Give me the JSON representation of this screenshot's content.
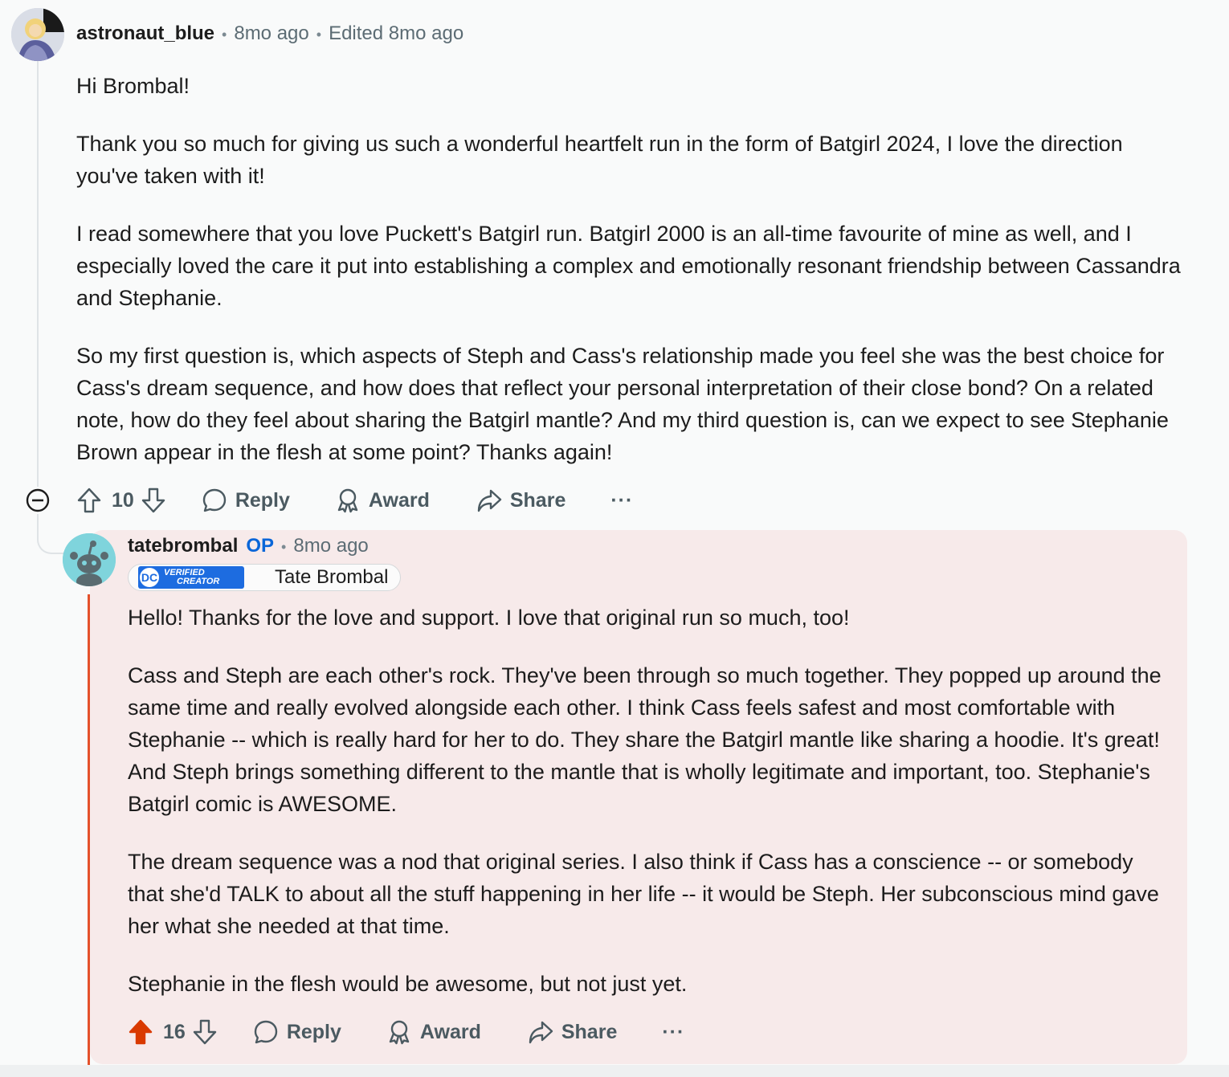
{
  "comment": {
    "username": "astronaut_blue",
    "time": "8mo ago",
    "edited": "Edited 8mo ago",
    "paragraphs": [
      "Hi Brombal!",
      "Thank you so much for giving us such a wonderful heartfelt run in the form of Batgirl 2024, I love the direction you've taken with it!",
      "I read somewhere that you love Puckett's Batgirl run. Batgirl 2000 is an all-time favourite of mine as well, and I especially loved the care it put into establishing a complex and emotionally resonant friendship between Cassandra and Stephanie.",
      "So my first question is, which aspects of Steph and Cass's relationship made you feel she was the best choice for Cass's dream sequence, and how does that reflect your personal interpretation of their close bond? On a related note, how do they feel about sharing the Batgirl mantle? And my third question is, can we expect to see Stephanie Brown appear in the flesh at some point? Thanks again!"
    ],
    "score": "10",
    "reply_label": "Reply",
    "award_label": "Award",
    "share_label": "Share",
    "more_label": "···"
  },
  "reply": {
    "username": "tatebrombal",
    "op_label": "OP",
    "time": "8mo ago",
    "flair": {
      "badge_logo": "DC",
      "badge_line1": "Verified",
      "badge_line2": "Creator",
      "name": "Tate Brombal"
    },
    "paragraphs": [
      "Hello! Thanks for the love and support. I love that original run so much, too!",
      "Cass and Steph are each other's rock. They've been through so much together. They popped up around the same time and really evolved alongside each other. I think Cass feels safest and most comfortable with Stephanie -- which is really hard for her to do. They share the Batgirl mantle like sharing a hoodie. It's great! And Steph brings something different to the mantle that is wholly legitimate and important, too. Stephanie's Batgirl comic is AWESOME.",
      "The dream sequence was a nod that original series. I also think if Cass has a conscience -- or somebody that she'd TALK to about all the stuff happening in her life -- it would be Steph. Her subconscious mind gave her what she needed at that time.",
      "Stephanie in the flesh would be awesome, but not just yet."
    ],
    "score": "16",
    "upvoted": true,
    "reply_label": "Reply",
    "award_label": "Award",
    "share_label": "Share",
    "more_label": "···"
  },
  "colors": {
    "upvote_active": "#d93a00",
    "op_blue": "#0a66d8",
    "reply_bg": "#f7eaea",
    "reply_line": "#e4512b"
  },
  "icons": [
    "upvote-icon",
    "downvote-icon",
    "comment-bubble-icon",
    "award-icon",
    "share-arrow-icon",
    "more-dots-icon",
    "collapse-minus-icon"
  ]
}
